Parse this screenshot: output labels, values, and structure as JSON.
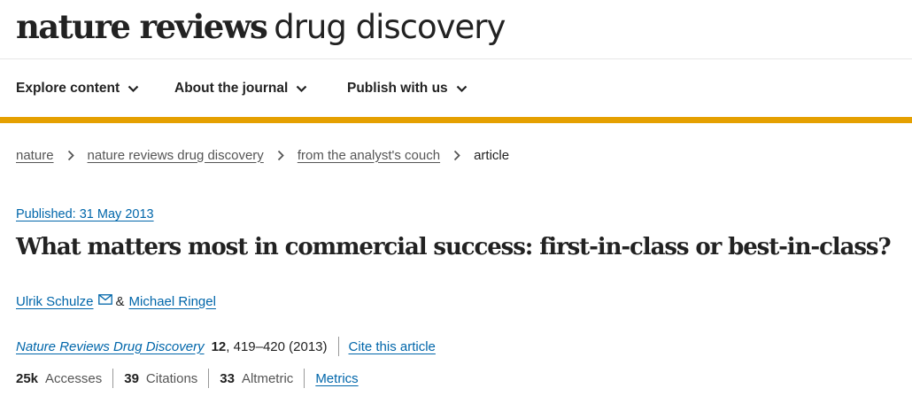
{
  "header": {
    "logo_bold": "nature reviews",
    "logo_light": "drug discovery"
  },
  "nav": {
    "items": [
      {
        "label": "Explore content"
      },
      {
        "label": "About the journal"
      },
      {
        "label": "Publish with us"
      }
    ],
    "accent_color": "#e5a000"
  },
  "breadcrumb": {
    "items": [
      {
        "label": "nature"
      },
      {
        "label": "nature reviews drug discovery"
      },
      {
        "label": "from the analyst's couch"
      }
    ],
    "current": "article"
  },
  "article": {
    "published": "Published: 31 May 2013",
    "title": "What matters most in commercial success: first-in-class or best-in-class?",
    "authors": [
      {
        "name": "Ulrik Schulze",
        "has_email_icon": true
      },
      {
        "name": "Michael Ringel"
      }
    ],
    "author_separator": "&",
    "journal": "Nature Reviews Drug Discovery",
    "volume": "12",
    "pages_year": ", 419–420 (2013)",
    "cite_label": "Cite this article"
  },
  "metrics": {
    "accesses_value": "25k",
    "accesses_label": "Accesses",
    "citations_value": "39",
    "citations_label": "Citations",
    "altmetric_value": "33",
    "altmetric_label": "Altmetric",
    "metrics_link": "Metrics"
  },
  "colors": {
    "link": "#0066aa",
    "text": "#222222",
    "muted": "#555555"
  },
  "icons": {
    "nav_chevron": "chevron-down-icon",
    "breadcrumb_separator": "chevron-right-icon",
    "author_email": "mail-icon"
  }
}
